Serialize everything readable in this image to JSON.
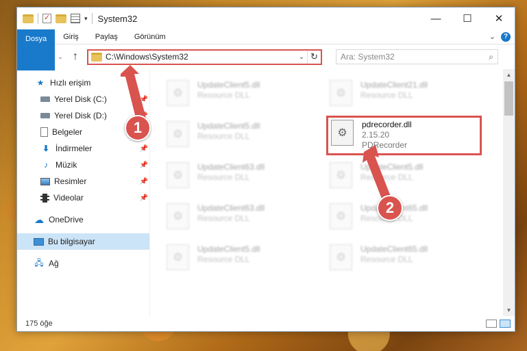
{
  "window": {
    "title": "System32",
    "controls": {
      "minimize": "—",
      "maximize": "☐",
      "close": "✕"
    }
  },
  "ribbon": {
    "tabs": [
      {
        "label": "Dosya",
        "active": true
      },
      {
        "label": "Giriş"
      },
      {
        "label": "Paylaş"
      },
      {
        "label": "Görünüm"
      }
    ],
    "help": "?"
  },
  "navigation": {
    "back": "←",
    "forward": "→",
    "recent": "⌄",
    "up": "↑",
    "address": "C:\\Windows\\System32",
    "search_placeholder": "Ara: System32"
  },
  "sidebar": {
    "items": [
      {
        "label": "Hızlı erişim",
        "icon": "star-icon"
      },
      {
        "label": "Yerel Disk (C:)",
        "icon": "drive-icon",
        "pinned": true
      },
      {
        "label": "Yerel Disk (D:)",
        "icon": "drive-icon",
        "pinned": true
      },
      {
        "label": "Belgeler",
        "icon": "document-icon",
        "pinned": true
      },
      {
        "label": "İndirmeler",
        "icon": "download-icon",
        "pinned": true
      },
      {
        "label": "Müzik",
        "icon": "music-icon",
        "pinned": true
      },
      {
        "label": "Resimler",
        "icon": "picture-icon",
        "pinned": true
      },
      {
        "label": "Videolar",
        "icon": "video-icon",
        "pinned": true
      },
      {
        "label": "OneDrive",
        "icon": "cloud-icon"
      },
      {
        "label": "Bu bilgisayar",
        "icon": "computer-icon",
        "selected": true
      },
      {
        "label": "Ağ",
        "icon": "network-icon"
      }
    ]
  },
  "files": [
    {
      "name": "UpdateClient5.dll",
      "sub": "Resource DLL"
    },
    {
      "name": "UpdateClient21.dll",
      "sub": "Resource DLL"
    },
    {
      "name": "UpdateClient5.dll",
      "sub": "Resource DLL"
    },
    {
      "name": "pdrecorder.dll",
      "version": "2.15.20",
      "sub": "PDRecorder",
      "highlighted": true
    },
    {
      "name": "UpdateClient63.dll",
      "sub": "Resource DLL"
    },
    {
      "name": "UpdateClient5.dll",
      "sub": "Resource DLL"
    },
    {
      "name": "UpdateClient63.dll",
      "sub": "Resource DLL"
    },
    {
      "name": "UpdateClient65.dll",
      "sub": "Resource DLL"
    },
    {
      "name": "UpdateClient5.dll",
      "sub": "Resource DLL"
    },
    {
      "name": "UpdateClient65.dll",
      "sub": "Resource DLL"
    }
  ],
  "status": {
    "count": "175 öğe"
  },
  "callouts": {
    "one": "1",
    "two": "2"
  },
  "colors": {
    "accent": "#1979ca",
    "highlight": "#d9534f",
    "selected_bg": "#cce4f7"
  }
}
